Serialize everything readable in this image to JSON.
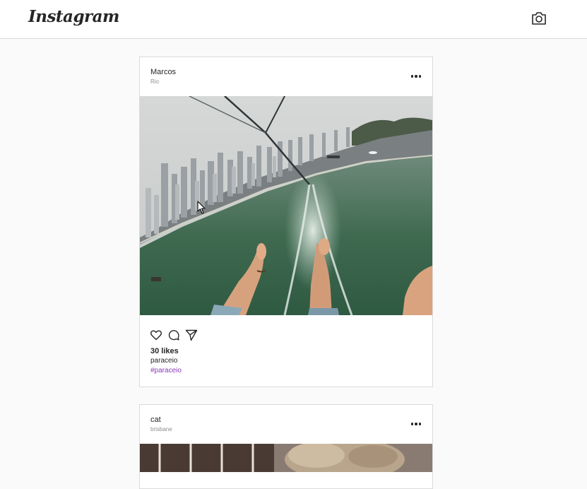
{
  "app": {
    "logo_text": "Instagram",
    "camera_icon": "camera-icon"
  },
  "posts": [
    {
      "username": "Marcos",
      "location": "Rio",
      "photo": "parasailing over bay with city skyline and boat wake",
      "likes": "30 likes",
      "caption": "paraceio",
      "hashtag": "#paraceio",
      "actions": [
        "heart-icon",
        "comment-icon",
        "share-icon"
      ]
    },
    {
      "username": "cat",
      "location": "brisbane",
      "photo": "cat photo"
    }
  ],
  "colors": {
    "background": "#fafafa",
    "border": "#dbdbdb",
    "hashtag": "#8a3ab9",
    "secondary_text": "#8e8e8e"
  }
}
